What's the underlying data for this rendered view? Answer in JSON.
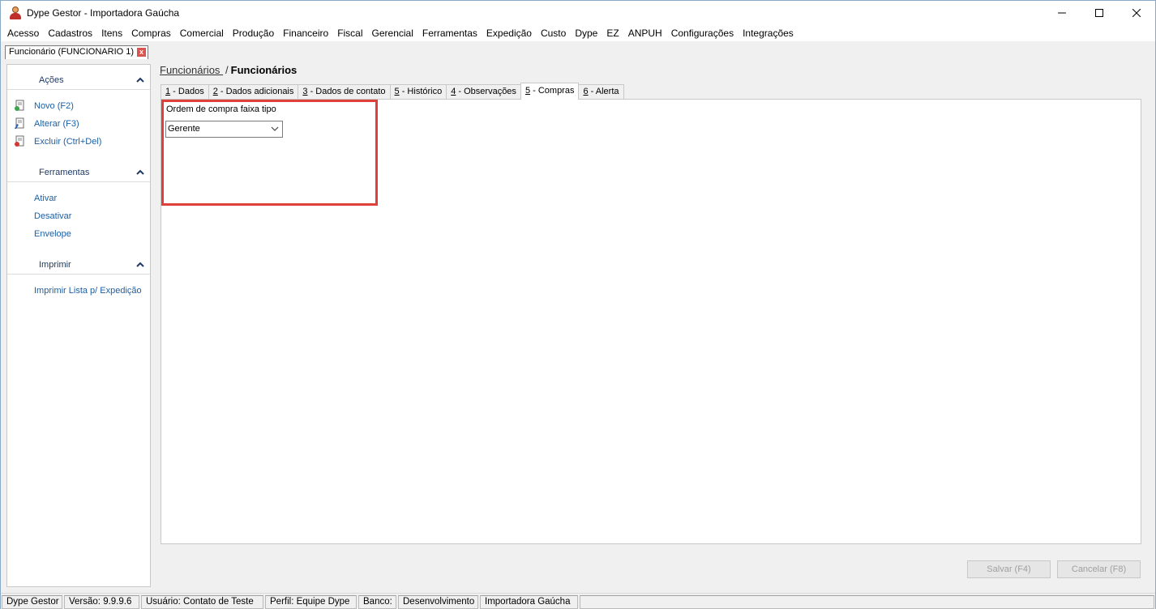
{
  "window": {
    "title": "Dype Gestor - Importadora Gaúcha",
    "controls": {
      "minimize": "—",
      "maximize": "☐",
      "close": "✕"
    }
  },
  "menu": [
    "Acesso",
    "Cadastros",
    "Itens",
    "Compras",
    "Comercial",
    "Produção",
    "Financeiro",
    "Fiscal",
    "Gerencial",
    "Ferramentas",
    "Expedição",
    "Custo",
    "Dype",
    "EZ",
    "ANPUH",
    "Configurações",
    "Integrações"
  ],
  "doc_tab": {
    "label": "Funcionário (FUNCIONARIO 1)",
    "close": "x"
  },
  "sidebar": {
    "acoes": {
      "title": "Ações",
      "items": [
        "Novo (F2)",
        "Alterar (F3)",
        "Excluir (Ctrl+Del)"
      ]
    },
    "ferramentas": {
      "title": "Ferramentas",
      "items": [
        "Ativar",
        "Desativar",
        "Envelope"
      ]
    },
    "imprimir": {
      "title": "Imprimir",
      "items": [
        "Imprimir Lista p/ Expedição"
      ]
    }
  },
  "breadcrumb": {
    "link": "Funcionários ",
    "separator": "/",
    "current": "Funcionários"
  },
  "tabs": [
    {
      "key": "1",
      "label": " - Dados"
    },
    {
      "key": "2",
      "label": " - Dados adicionais"
    },
    {
      "key": "3",
      "label": " - Dados de contato"
    },
    {
      "key": "5",
      "label": " - Histórico"
    },
    {
      "key": "4",
      "label": " - Observações"
    },
    {
      "key": "5",
      "label": " - Compras"
    },
    {
      "key": "6",
      "label": " - Alerta"
    }
  ],
  "active_tab_index": 5,
  "compras": {
    "field_label": "Ordem de compra faixa tipo",
    "select_value": "Gerente"
  },
  "buttons": {
    "save": "Salvar (F4)",
    "cancel": "Cancelar (F8)"
  },
  "status": [
    "Dype Gestor",
    "Versão: 9.9.9.6",
    "Usuário: Contato de Teste",
    "Perfil: Equipe Dype",
    "Banco:",
    "Desenvolvimento",
    "Importadora Gaúcha",
    ""
  ],
  "colors": {
    "highlight": "#e0403a",
    "link": "#1c5fa5",
    "section_title": "#1f3a64"
  }
}
